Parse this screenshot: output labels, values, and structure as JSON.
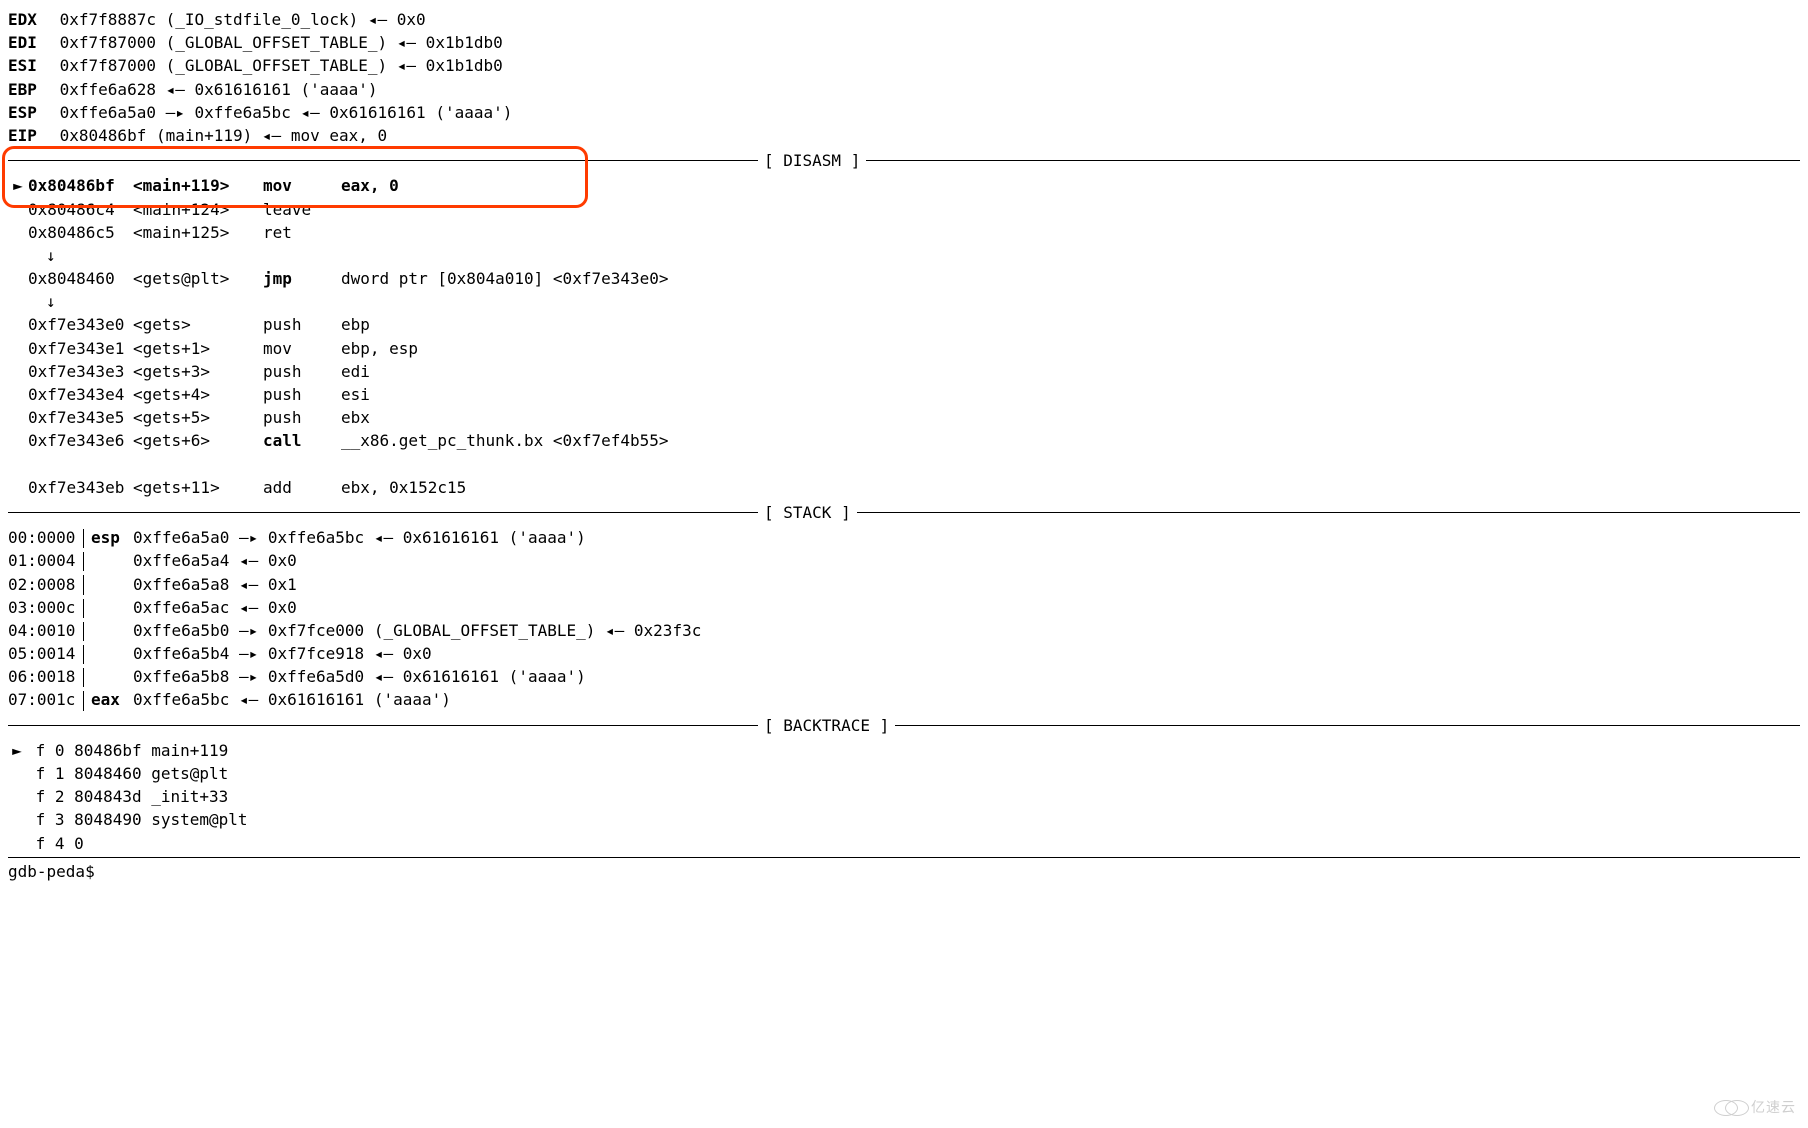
{
  "registers": [
    {
      "name": "EDX",
      "value": "0xf7f8887c (_IO_stdfile_0_lock) ◂— 0x0"
    },
    {
      "name": "EDI",
      "value": "0xf7f87000 (_GLOBAL_OFFSET_TABLE_) ◂— 0x1b1db0"
    },
    {
      "name": "ESI",
      "value": "0xf7f87000 (_GLOBAL_OFFSET_TABLE_) ◂— 0x1b1db0"
    },
    {
      "name": "EBP",
      "value": "0xffe6a628 ◂— 0x61616161 ('aaaa')"
    },
    {
      "name": "ESP",
      "value": "0xffe6a5a0 —▸ 0xffe6a5bc ◂— 0x61616161 ('aaaa')"
    },
    {
      "name": "EIP",
      "value": "0x80486bf (main+119) ◂— mov    eax, 0"
    }
  ],
  "section_disasm": "[ DISASM ]",
  "section_stack": "[ STACK ]",
  "section_backtrace": "[ BACKTRACE ]",
  "disasm": [
    {
      "prefix": "►",
      "addr": "0x80486bf",
      "sym": "<main+119>",
      "mnem": "mov",
      "ops": "eax, 0",
      "bold": true
    },
    {
      "prefix": "",
      "addr": "0x80486c4",
      "sym": "<main+124>",
      "mnem": "leave",
      "ops": ""
    },
    {
      "prefix": "",
      "addr": "0x80486c5",
      "sym": "<main+125>",
      "mnem": "ret",
      "ops": ""
    },
    {
      "prefix": "",
      "addr": "",
      "sym": "",
      "mnem": "",
      "ops": "",
      "arrow": true
    },
    {
      "prefix": "",
      "addr": "0x8048460",
      "sym": "<gets@plt>",
      "mnem": "jmp",
      "ops": "dword ptr [0x804a010] <0xf7e343e0>",
      "mnembold": true
    },
    {
      "prefix": "",
      "addr": "",
      "sym": "",
      "mnem": "",
      "ops": "",
      "arrow": true
    },
    {
      "prefix": "",
      "addr": "0xf7e343e0",
      "sym": "<gets>",
      "mnem": "push",
      "ops": "ebp"
    },
    {
      "prefix": "",
      "addr": "0xf7e343e1",
      "sym": "<gets+1>",
      "mnem": "mov",
      "ops": "ebp, esp"
    },
    {
      "prefix": "",
      "addr": "0xf7e343e3",
      "sym": "<gets+3>",
      "mnem": "push",
      "ops": "edi"
    },
    {
      "prefix": "",
      "addr": "0xf7e343e4",
      "sym": "<gets+4>",
      "mnem": "push",
      "ops": "esi"
    },
    {
      "prefix": "",
      "addr": "0xf7e343e5",
      "sym": "<gets+5>",
      "mnem": "push",
      "ops": "ebx"
    },
    {
      "prefix": "",
      "addr": "0xf7e343e6",
      "sym": "<gets+6>",
      "mnem": "call",
      "ops": "__x86.get_pc_thunk.bx <0xf7ef4b55>",
      "mnembold": true
    },
    {
      "prefix": "",
      "addr": "",
      "sym": "",
      "mnem": "",
      "ops": "",
      "blank": true
    },
    {
      "prefix": "",
      "addr": "0xf7e343eb",
      "sym": "<gets+11>",
      "mnem": "add",
      "ops": "ebx, 0x152c15"
    }
  ],
  "stack": [
    {
      "offset": "00:0000",
      "reg": "esp",
      "value": "0xffe6a5a0 —▸ 0xffe6a5bc ◂— 0x61616161 ('aaaa')"
    },
    {
      "offset": "01:0004",
      "reg": "",
      "value": "0xffe6a5a4 ◂— 0x0"
    },
    {
      "offset": "02:0008",
      "reg": "",
      "value": "0xffe6a5a8 ◂— 0x1"
    },
    {
      "offset": "03:000c",
      "reg": "",
      "value": "0xffe6a5ac ◂— 0x0"
    },
    {
      "offset": "04:0010",
      "reg": "",
      "value": "0xffe6a5b0 —▸ 0xf7fce000 (_GLOBAL_OFFSET_TABLE_) ◂— 0x23f3c"
    },
    {
      "offset": "05:0014",
      "reg": "",
      "value": "0xffe6a5b4 —▸ 0xf7fce918 ◂— 0x0"
    },
    {
      "offset": "06:0018",
      "reg": "",
      "value": "0xffe6a5b8 —▸ 0xffe6a5d0 ◂— 0x61616161 ('aaaa')"
    },
    {
      "offset": "07:001c",
      "reg": "eax",
      "value": "0xffe6a5bc ◂— 0x61616161 ('aaaa')"
    }
  ],
  "backtrace": [
    {
      "prefix": "►",
      "frame": "f 0",
      "addr": "80486bf",
      "sym": "main+119"
    },
    {
      "prefix": "",
      "frame": "f 1",
      "addr": "8048460",
      "sym": "gets@plt"
    },
    {
      "prefix": "",
      "frame": "f 2",
      "addr": "804843d",
      "sym": "_init+33"
    },
    {
      "prefix": "",
      "frame": "f 3",
      "addr": "8048490",
      "sym": "system@plt"
    },
    {
      "prefix": "",
      "frame": "f 4",
      "addr": "      0",
      "sym": ""
    }
  ],
  "prompt": "gdb-peda$",
  "watermark": "亿速云"
}
